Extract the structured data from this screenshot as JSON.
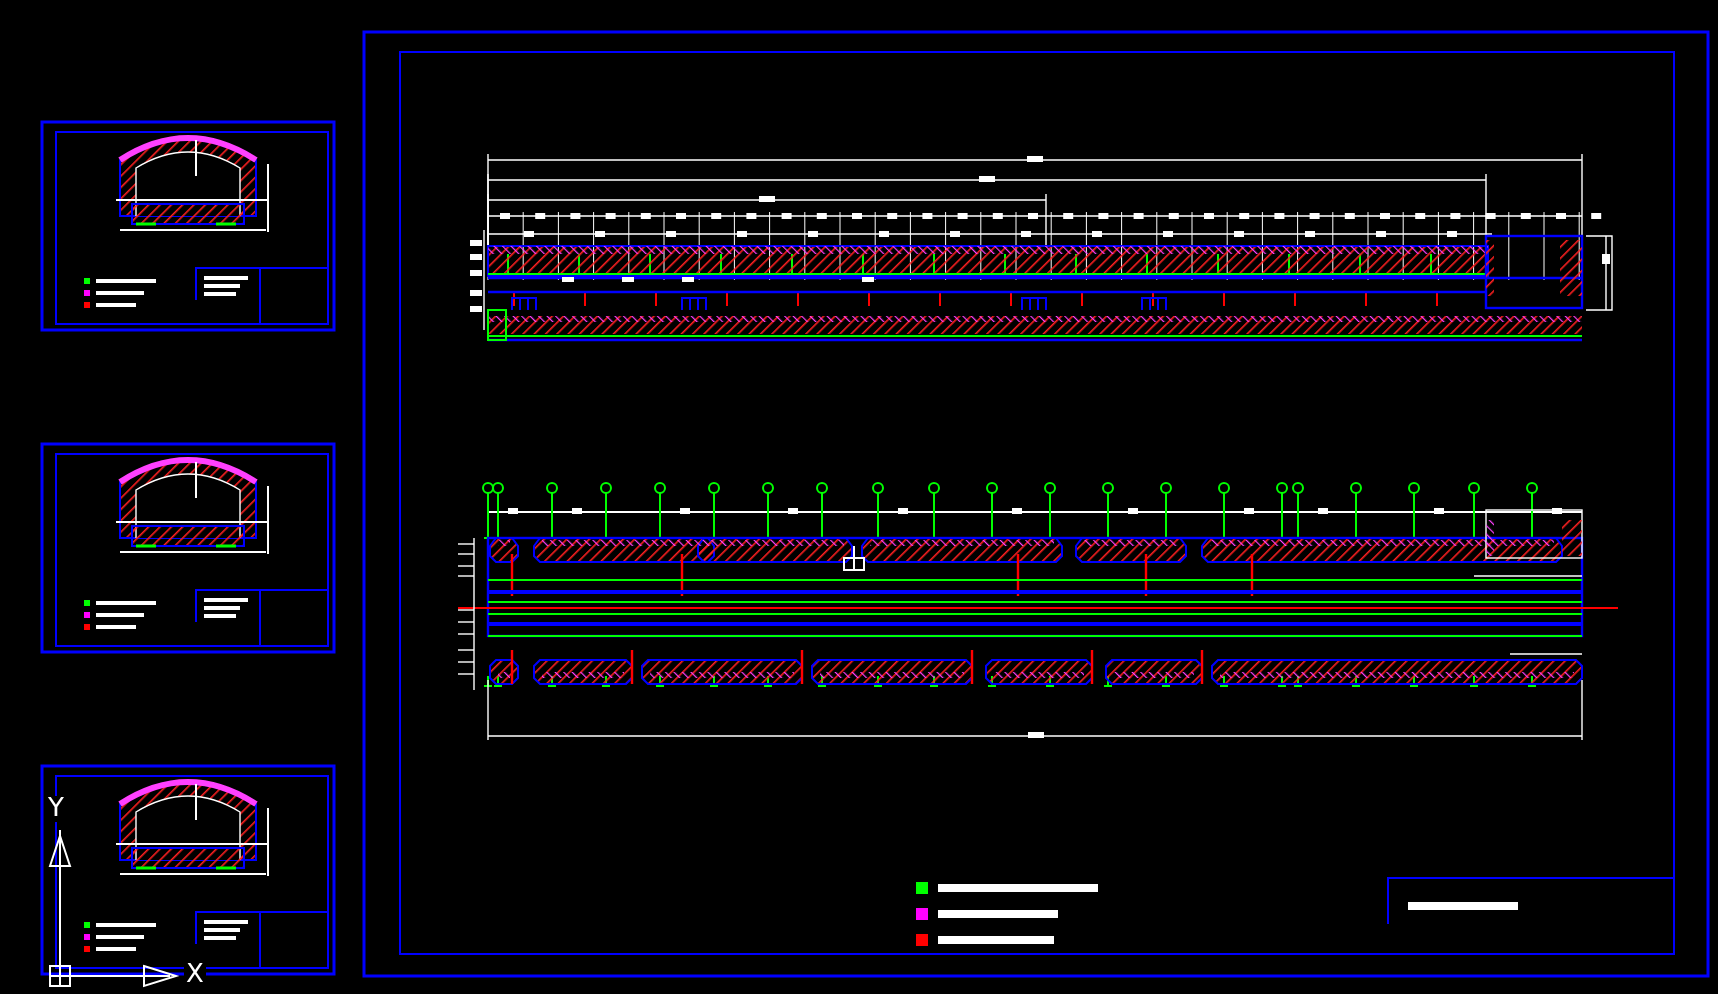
{
  "ucs": {
    "y_label": "Y",
    "x_label": "X"
  },
  "legend": [
    {
      "color": "#00ff00"
    },
    {
      "color": "#ff00ff"
    },
    {
      "color": "#ff0000"
    }
  ]
}
